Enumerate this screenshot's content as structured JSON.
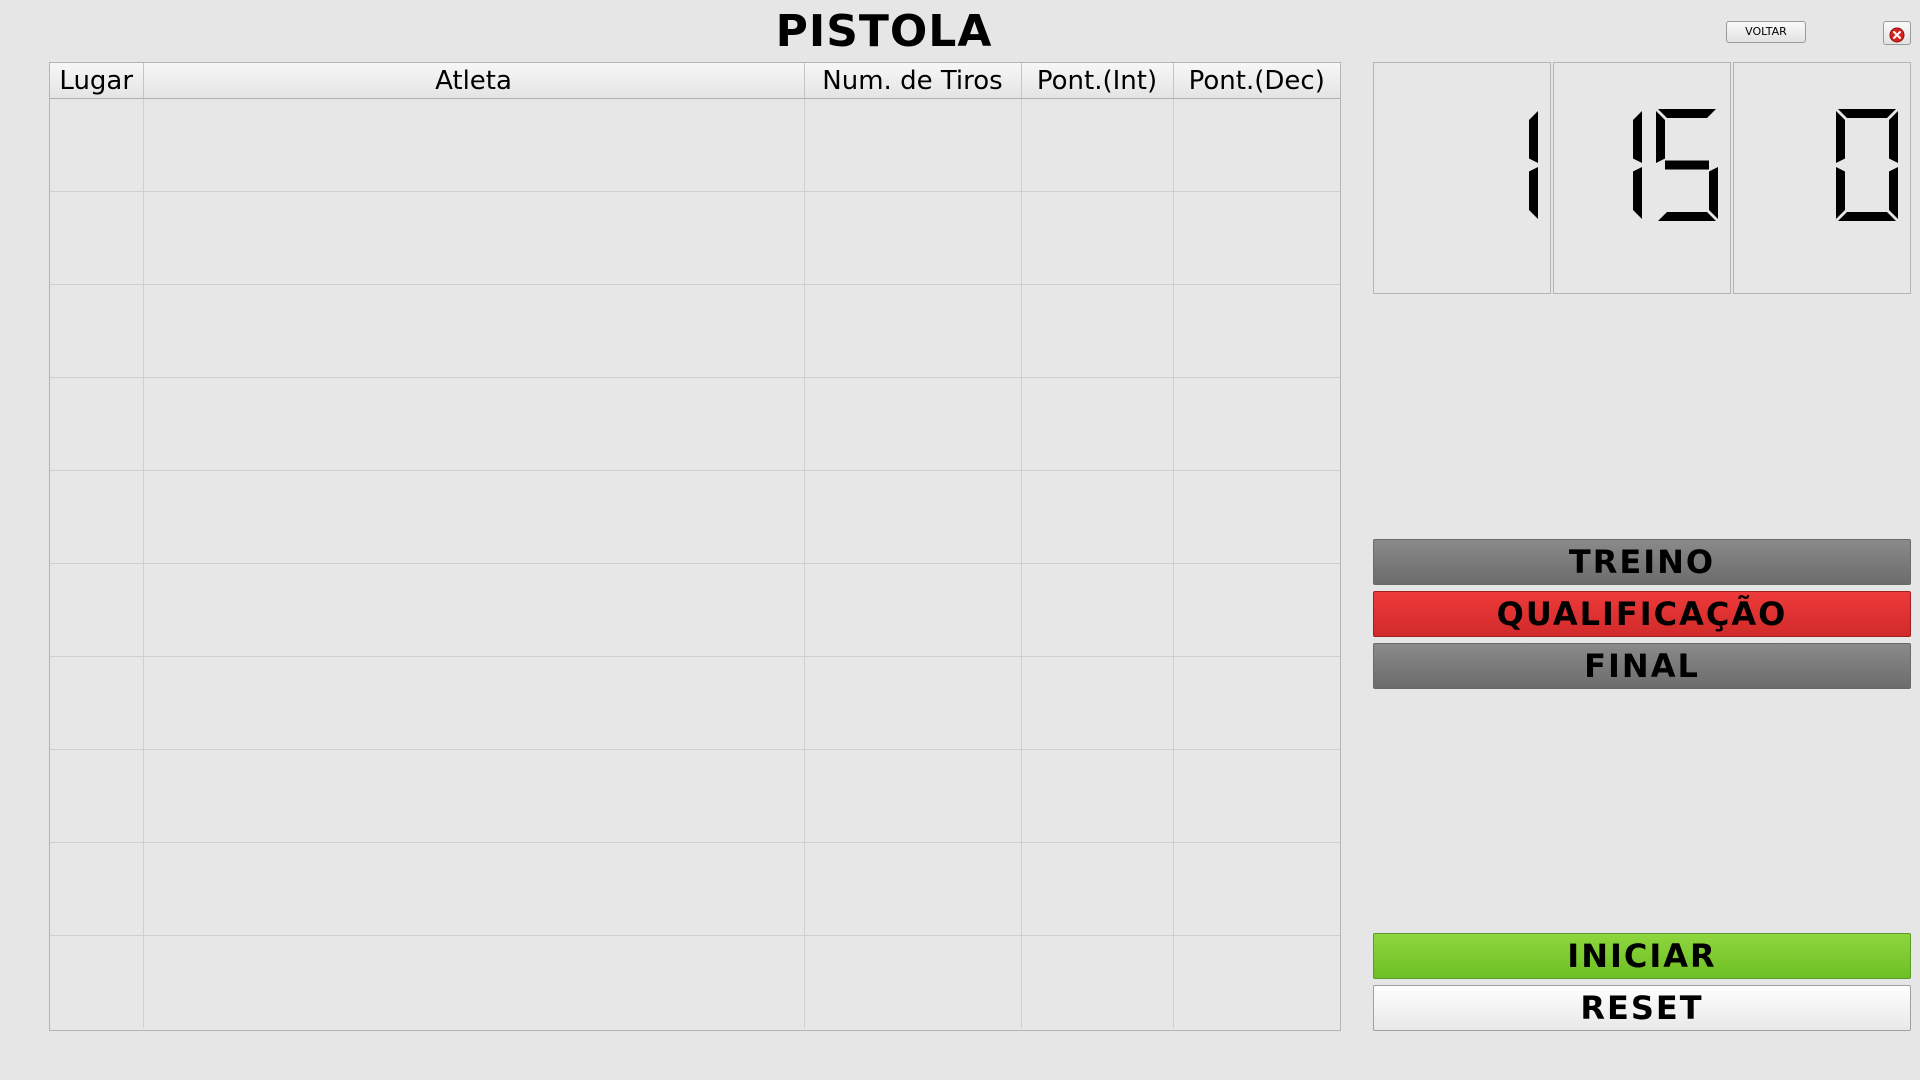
{
  "header": {
    "title": "PISTOLA",
    "back_label": "VOLTAR",
    "close_icon": "close-icon"
  },
  "table": {
    "columns": [
      "Lugar",
      "Atleta",
      "Num. de Tiros",
      "Pont.(Int)",
      "Pont.(Dec)"
    ],
    "rows": [
      [
        "",
        "",
        "",
        "",
        ""
      ],
      [
        "",
        "",
        "",
        "",
        ""
      ],
      [
        "",
        "",
        "",
        "",
        ""
      ],
      [
        "",
        "",
        "",
        "",
        ""
      ],
      [
        "",
        "",
        "",
        "",
        ""
      ],
      [
        "",
        "",
        "",
        "",
        ""
      ],
      [
        "",
        "",
        "",
        "",
        ""
      ],
      [
        "",
        "",
        "",
        "",
        ""
      ],
      [
        "",
        "",
        "",
        "",
        ""
      ],
      [
        "",
        "",
        "",
        "",
        ""
      ]
    ]
  },
  "timer": {
    "display": [
      "1",
      "15",
      "0"
    ]
  },
  "modes": {
    "treino": "TREINO",
    "qualificacao": "QUALIFICAÇÃO",
    "final": "FINAL",
    "active": "QUALIFICAÇÃO"
  },
  "controls": {
    "start_label": "INICIAR",
    "reset_label": "RESET"
  },
  "colors": {
    "background": "#e6e6e6",
    "mode_inactive": "#7a7a7a",
    "mode_active": "#e03232",
    "start": "#7ccc30",
    "reset": "#f4f4f4"
  }
}
